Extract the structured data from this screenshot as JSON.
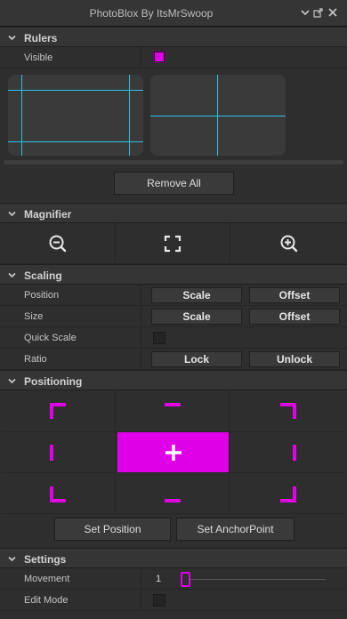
{
  "window": {
    "title": "PhotoBlox By ItsMrSwoop"
  },
  "sections": {
    "rulers": "Rulers",
    "magnifier": "Magnifier",
    "scaling": "Scaling",
    "positioning": "Positioning",
    "settings": "Settings"
  },
  "rulers": {
    "visible_label": "Visible",
    "visible_checked": true,
    "remove_all_label": "Remove All"
  },
  "magnifier": {
    "icons": [
      "zoom-out-icon",
      "fit-screen-icon",
      "zoom-in-icon"
    ]
  },
  "scaling": {
    "position_label": "Position",
    "size_label": "Size",
    "quick_scale_label": "Quick Scale",
    "quick_scale_checked": false,
    "ratio_label": "Ratio",
    "scale_label": "Scale",
    "offset_label": "Offset",
    "lock_label": "Lock",
    "unlock_label": "Unlock"
  },
  "positioning": {
    "selected_anchor": "center",
    "set_position_label": "Set Position",
    "set_anchorpoint_label": "Set AnchorPoint"
  },
  "settings": {
    "movement_label": "Movement",
    "movement_value": "1",
    "edit_mode_label": "Edit Mode",
    "edit_mode_checked": false
  },
  "colors": {
    "accent": "#e000e8",
    "ruler_line": "#2ac4e6",
    "panel_bg": "#2e2e2e",
    "header_bg": "#353535"
  }
}
